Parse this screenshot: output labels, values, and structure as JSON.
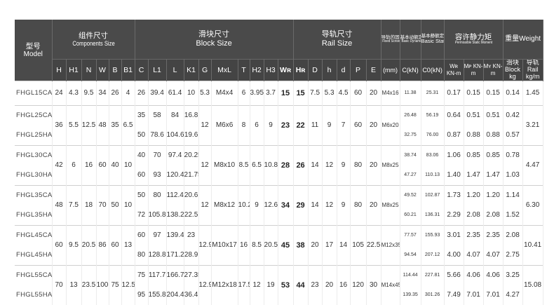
{
  "headers": {
    "model": {
      "cn": "型号",
      "en": "Model"
    },
    "components": {
      "cn": "组件尺寸",
      "en": "Components Size"
    },
    "block": {
      "cn": "滑块尺寸",
      "en": "Block Size"
    },
    "rail": {
      "cn": "导轨尺寸",
      "en": "Rail Size"
    },
    "screw": {
      "cn": "导轨的固定螺栓尺寸",
      "en": "Fixed Screw Size"
    },
    "dyn": {
      "cn": "基本动额定负荷",
      "en": "Basic Dynamic Load Rating"
    },
    "stat": {
      "cn": "基本静额定负荷",
      "en": "Basic Static Rating"
    },
    "moment": {
      "cn": "容许静力矩",
      "en": "Permissible Static Moment"
    },
    "weight": {
      "label": "重量Weight"
    }
  },
  "columns": {
    "H": "H",
    "H1": "H1",
    "N": "N",
    "W": "W",
    "B": "B",
    "B1": "B1",
    "C": "C",
    "L1": "L1",
    "L": "L",
    "K1": "K1",
    "G": "G",
    "MxL": "MxL",
    "T": "T",
    "H2": "H2",
    "H3": "H3",
    "WR": "Wʀ",
    "HR": "Hʀ",
    "D": "D",
    "h": "h",
    "d": "d",
    "P": "P",
    "E": "E",
    "mm": "(mm)",
    "CkN": "C(kN)",
    "C0kN": "C0(kN)",
    "MR": "Wʀ KN-m",
    "MP": "Mᴘ KN-m",
    "MY": "Mʏ KN-m",
    "block_kg": "滑块 Block kg",
    "rail_kg": "导轨 Rail kg/m"
  },
  "groups": [
    {
      "rows": [
        {
          "model": "FHGL15CA",
          "H": "24",
          "H1": "4.3",
          "N": "9.5",
          "W": "34",
          "B": "26",
          "B1": "4",
          "C": "26",
          "L1": "39.4",
          "L": "61.4",
          "K1": "10",
          "G": "5.3",
          "MxL": "M4x4",
          "T": "6",
          "H2": "3.95",
          "H3": "3.7",
          "WR": "15",
          "HR": "15",
          "D": "7.5",
          "h": "5.3",
          "d": "4.5",
          "P": "60",
          "E": "20",
          "screw": "M4x16",
          "C_kN": "11.38",
          "C0_kN": "25.31",
          "MR": "0.17",
          "MP": "0.15",
          "MY": "0.15",
          "block": "0.14",
          "rail": "1.45"
        }
      ]
    },
    {
      "shared": {
        "H": "36",
        "H1": "5.5",
        "N": "12.5",
        "W": "48",
        "B": "35",
        "B1": "6.5",
        "G": "12",
        "MxL": "M6x6",
        "T": "8",
        "H2": "6",
        "H3": "9",
        "WR": "23",
        "HR": "22",
        "D": "11",
        "h": "9",
        "d": "7",
        "P": "60",
        "E": "20",
        "screw": "M6x20",
        "rail": "3.21"
      },
      "rows": [
        {
          "model": "FHGL25CA",
          "C": "35",
          "L1": "58",
          "L": "84",
          "K1": "16.8",
          "C_kN": "26.48",
          "C0_kN": "56.19",
          "MR": "0.64",
          "MP": "0.51",
          "MY": "0.51",
          "block": "0.42"
        },
        {
          "model": "FHGL25HA",
          "C": "50",
          "L1": "78.6",
          "L": "104.6",
          "K1": "19.6",
          "C_kN": "32.75",
          "C0_kN": "76.00",
          "MR": "0.87",
          "MP": "0.88",
          "MY": "0.88",
          "block": "0.57"
        }
      ]
    },
    {
      "shared": {
        "H": "42",
        "H1": "6",
        "N": "16",
        "W": "60",
        "B": "40",
        "B1": "10",
        "G": "12",
        "MxL": "M8x10",
        "T": "8.5",
        "H2": "6.5",
        "H3": "10.8",
        "WR": "28",
        "HR": "26",
        "D": "14",
        "h": "12",
        "d": "9",
        "P": "80",
        "E": "20",
        "screw": "M8x25",
        "rail": "4.47"
      },
      "rows": [
        {
          "model": "FHGL30CA",
          "C": "40",
          "L1": "70",
          "L": "97.4",
          "K1": "20.25",
          "C_kN": "38.74",
          "C0_kN": "83.06",
          "MR": "1.06",
          "MP": "0.85",
          "MY": "0.85",
          "block": "0.78"
        },
        {
          "model": "FHGL30HA",
          "C": "60",
          "L1": "93",
          "L": "120.4",
          "K1": "21.75",
          "C_kN": "47.27",
          "C0_kN": "110.13",
          "MR": "1.40",
          "MP": "1.47",
          "MY": "1.47",
          "block": "1.03"
        }
      ]
    },
    {
      "shared": {
        "H": "48",
        "H1": "7.5",
        "N": "18",
        "W": "70",
        "B": "50",
        "B1": "10",
        "G": "12",
        "MxL": "M8x12",
        "T": "10.2",
        "H2": "9",
        "H3": "12.6",
        "WR": "34",
        "HR": "29",
        "D": "14",
        "h": "12",
        "d": "9",
        "P": "80",
        "E": "20",
        "screw": "M8x25",
        "rail": "6.30"
      },
      "rows": [
        {
          "model": "FHGL35CA",
          "C": "50",
          "L1": "80",
          "L": "112.4",
          "K1": "20.6",
          "C_kN": "49.52",
          "C0_kN": "102.87",
          "MR": "1.73",
          "MP": "1.20",
          "MY": "1.20",
          "block": "1.14"
        },
        {
          "model": "FHGL35HA",
          "C": "72",
          "L1": "105.8",
          "L": "138.2",
          "K1": "22.5",
          "C_kN": "60.21",
          "C0_kN": "136.31",
          "MR": "2.29",
          "MP": "2.08",
          "MY": "2.08",
          "block": "1.52"
        }
      ]
    },
    {
      "shared": {
        "H": "60",
        "H1": "9.5",
        "N": "20.5",
        "W": "86",
        "B": "60",
        "B1": "13",
        "G": "12.9",
        "MxL": "M10x17",
        "T": "16",
        "H2": "8.5",
        "H3": "20.5",
        "WR": "45",
        "HR": "38",
        "D": "20",
        "h": "17",
        "d": "14",
        "P": "105",
        "E": "22.5",
        "screw": "M12x35",
        "rail": "10.41"
      },
      "rows": [
        {
          "model": "FHGL45CA",
          "C": "60",
          "L1": "97",
          "L": "139.4",
          "K1": "23",
          "C_kN": "77.57",
          "C0_kN": "155.93",
          "MR": "3.01",
          "MP": "2.35",
          "MY": "2.35",
          "block": "2.08"
        },
        {
          "model": "FHGL45HA",
          "C": "80",
          "L1": "128.8",
          "L": "171.2",
          "K1": "28.9",
          "C_kN": "94.54",
          "C0_kN": "207.12",
          "MR": "4.00",
          "MP": "4.07",
          "MY": "4.07",
          "block": "2.75"
        }
      ]
    },
    {
      "shared": {
        "H": "70",
        "H1": "13",
        "N": "23.5",
        "W": "100",
        "B": "75",
        "B1": "12.5",
        "G": "12.9",
        "MxL": "M12x18",
        "T": "17.5",
        "H2": "12",
        "H3": "19",
        "WR": "53",
        "HR": "44",
        "D": "23",
        "h": "20",
        "d": "16",
        "P": "120",
        "E": "30",
        "screw": "M14x45",
        "rail": "15.08"
      },
      "rows": [
        {
          "model": "FHGL55CA",
          "C": "75",
          "L1": "117.7",
          "L": "166.7",
          "K1": "27.35",
          "C_kN": "114.44",
          "C0_kN": "227.81",
          "MR": "5.66",
          "MP": "4.06",
          "MY": "4.06",
          "block": "3.25"
        },
        {
          "model": "FHGL55HA",
          "C": "95",
          "L1": "155.8",
          "L": "204.4",
          "K1": "36.4",
          "C_kN": "139.35",
          "C0_kN": "301.26",
          "MR": "7.49",
          "MP": "7.01",
          "MY": "7.01",
          "block": "4.27"
        }
      ]
    }
  ]
}
